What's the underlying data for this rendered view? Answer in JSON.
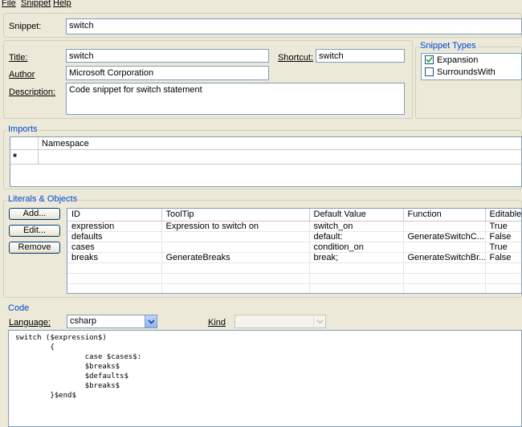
{
  "menu": {
    "file": "File",
    "snippet": "Snippet",
    "help": "Help"
  },
  "snippet_field": {
    "label": "Snippet:",
    "value": "switch"
  },
  "header": {
    "title_label": "Title:",
    "title_value": "switch",
    "shortcut_label": "Shortcut:",
    "shortcut_value": "switch",
    "author_label": "Author",
    "author_value": "Microsoft Corporation",
    "description_label": "Description:",
    "description_value": "Code snippet for switch statement"
  },
  "snippet_types": {
    "title": "Snippet Types",
    "items": [
      {
        "label": "Expansion",
        "checked": true
      },
      {
        "label": "SurroundsWith",
        "checked": false
      }
    ]
  },
  "imports": {
    "title": "Imports",
    "column": "Namespace",
    "new_row_marker": "*"
  },
  "literals": {
    "title": "Literals & Objects",
    "buttons": {
      "add": "Add...",
      "edit": "Edit...",
      "remove": "Remove"
    },
    "columns": [
      "ID",
      "ToolTip",
      "Default Value",
      "Function",
      "Editable"
    ],
    "rows": [
      [
        "expression",
        "Expression to switch on",
        "switch_on",
        "",
        "True"
      ],
      [
        "defaults",
        "",
        "default:",
        "GenerateSwitchC...",
        "False"
      ],
      [
        "cases",
        "",
        "condition_on",
        "",
        "True"
      ],
      [
        "breaks",
        "GenerateBreaks",
        "break;",
        "GenerateSwitchBr...",
        "False"
      ]
    ]
  },
  "code": {
    "title": "Code",
    "language_label": "Language:",
    "language_value": "csharp",
    "kind_label": "Kind",
    "kind_value": "",
    "lines": [
      "switch ($expression$)",
      "        {",
      "                case $cases$:",
      "                $breaks$",
      "                $defaults$",
      "                $breaks$",
      "        }$end$"
    ]
  }
}
